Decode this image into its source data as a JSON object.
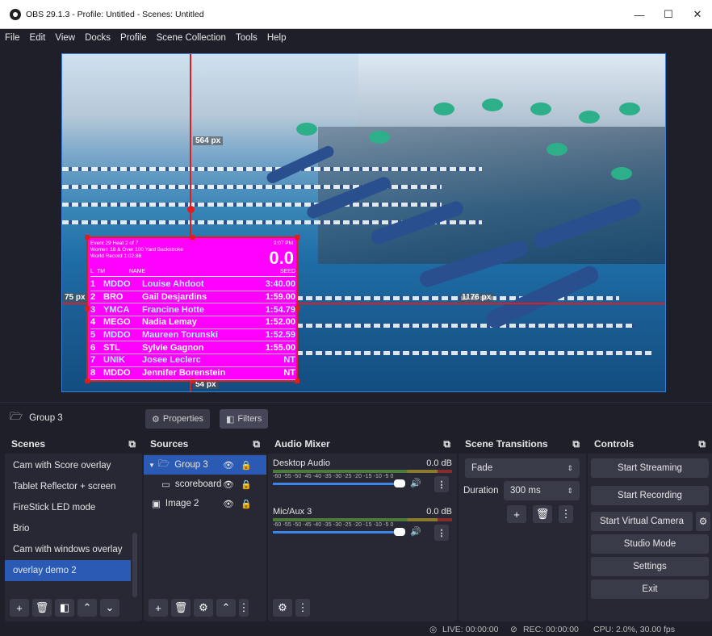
{
  "window": {
    "title": "OBS 29.1.3 - Profile: Untitled - Scenes: Untitled",
    "minimize": "—",
    "maximize": "☐",
    "close": "✕"
  },
  "menu": [
    "File",
    "Edit",
    "View",
    "Docks",
    "Profile",
    "Scene Collection",
    "Tools",
    "Help"
  ],
  "preview": {
    "guide_top": "564 px",
    "guide_left": "75 px",
    "guide_right": "1176 px",
    "guide_bottom": "54 px"
  },
  "scoreboard": {
    "event": "Event 29 Heat 2 of 7",
    "race": "Women 18 & Over 100 Yard Backstroke",
    "record": "World Record 1:02.88",
    "clock": "9:07 PM",
    "elapsed": "0.0",
    "col_lane": "L",
    "col_team": "TM",
    "col_name": "NAME",
    "col_seed": "SEED",
    "rows": [
      {
        "lane": "1",
        "team": "MDDO",
        "name": "Louise Ahdoot",
        "seed": "3:40.00"
      },
      {
        "lane": "2",
        "team": "BRO",
        "name": "Gail Desjardins",
        "seed": "1:59.00"
      },
      {
        "lane": "3",
        "team": "YMCA",
        "name": "Francine Hotte",
        "seed": "1:54.79"
      },
      {
        "lane": "4",
        "team": "MEGO",
        "name": "Nadia Lemay",
        "seed": "1:52.00"
      },
      {
        "lane": "5",
        "team": "MDDO",
        "name": "Maureen Torunski",
        "seed": "1:52.59"
      },
      {
        "lane": "6",
        "team": "STL",
        "name": "Sylvie Gagnon",
        "seed": "1:55.00"
      },
      {
        "lane": "7",
        "team": "UNIK",
        "name": "Josee Leclerc",
        "seed": "NT"
      },
      {
        "lane": "8",
        "team": "MDDO",
        "name": "Jennifer Borenstein",
        "seed": "NT"
      }
    ]
  },
  "context": {
    "source_name": "Group 3",
    "properties": "Properties",
    "filters": "Filters"
  },
  "docks": {
    "scenes": {
      "title": "Scenes",
      "items": [
        "Cam with Score overlay",
        "Tablet Reflector + screen",
        "FireStick LED mode",
        "Brio",
        "Cam with windows overlay",
        "overlay demo 2"
      ]
    },
    "sources": {
      "title": "Sources",
      "items": [
        {
          "label": "Group 3"
        },
        {
          "label": "scoreboard"
        },
        {
          "label": "Image 2"
        }
      ]
    },
    "mixer": {
      "title": "Audio Mixer",
      "channels": [
        {
          "name": "Desktop Audio",
          "level": "0.0 dB"
        },
        {
          "name": "Mic/Aux 3",
          "level": "0.0 dB"
        }
      ],
      "scale": "-60 -55 -50 -45 -40 -35 -30 -25 -20 -15 -10 -5 0"
    },
    "transitions": {
      "title": "Scene Transitions",
      "transition": "Fade",
      "duration_label": "Duration",
      "duration": "300 ms"
    },
    "controls": {
      "title": "Controls",
      "buttons": [
        "Start Streaming",
        "Start Recording",
        "Start Virtual Camera",
        "Studio Mode",
        "Settings",
        "Exit"
      ]
    }
  },
  "status": {
    "live": "LIVE: 00:00:00",
    "rec": "REC: 00:00:00",
    "cpu": "CPU: 2.0%, 30.00 fps"
  }
}
